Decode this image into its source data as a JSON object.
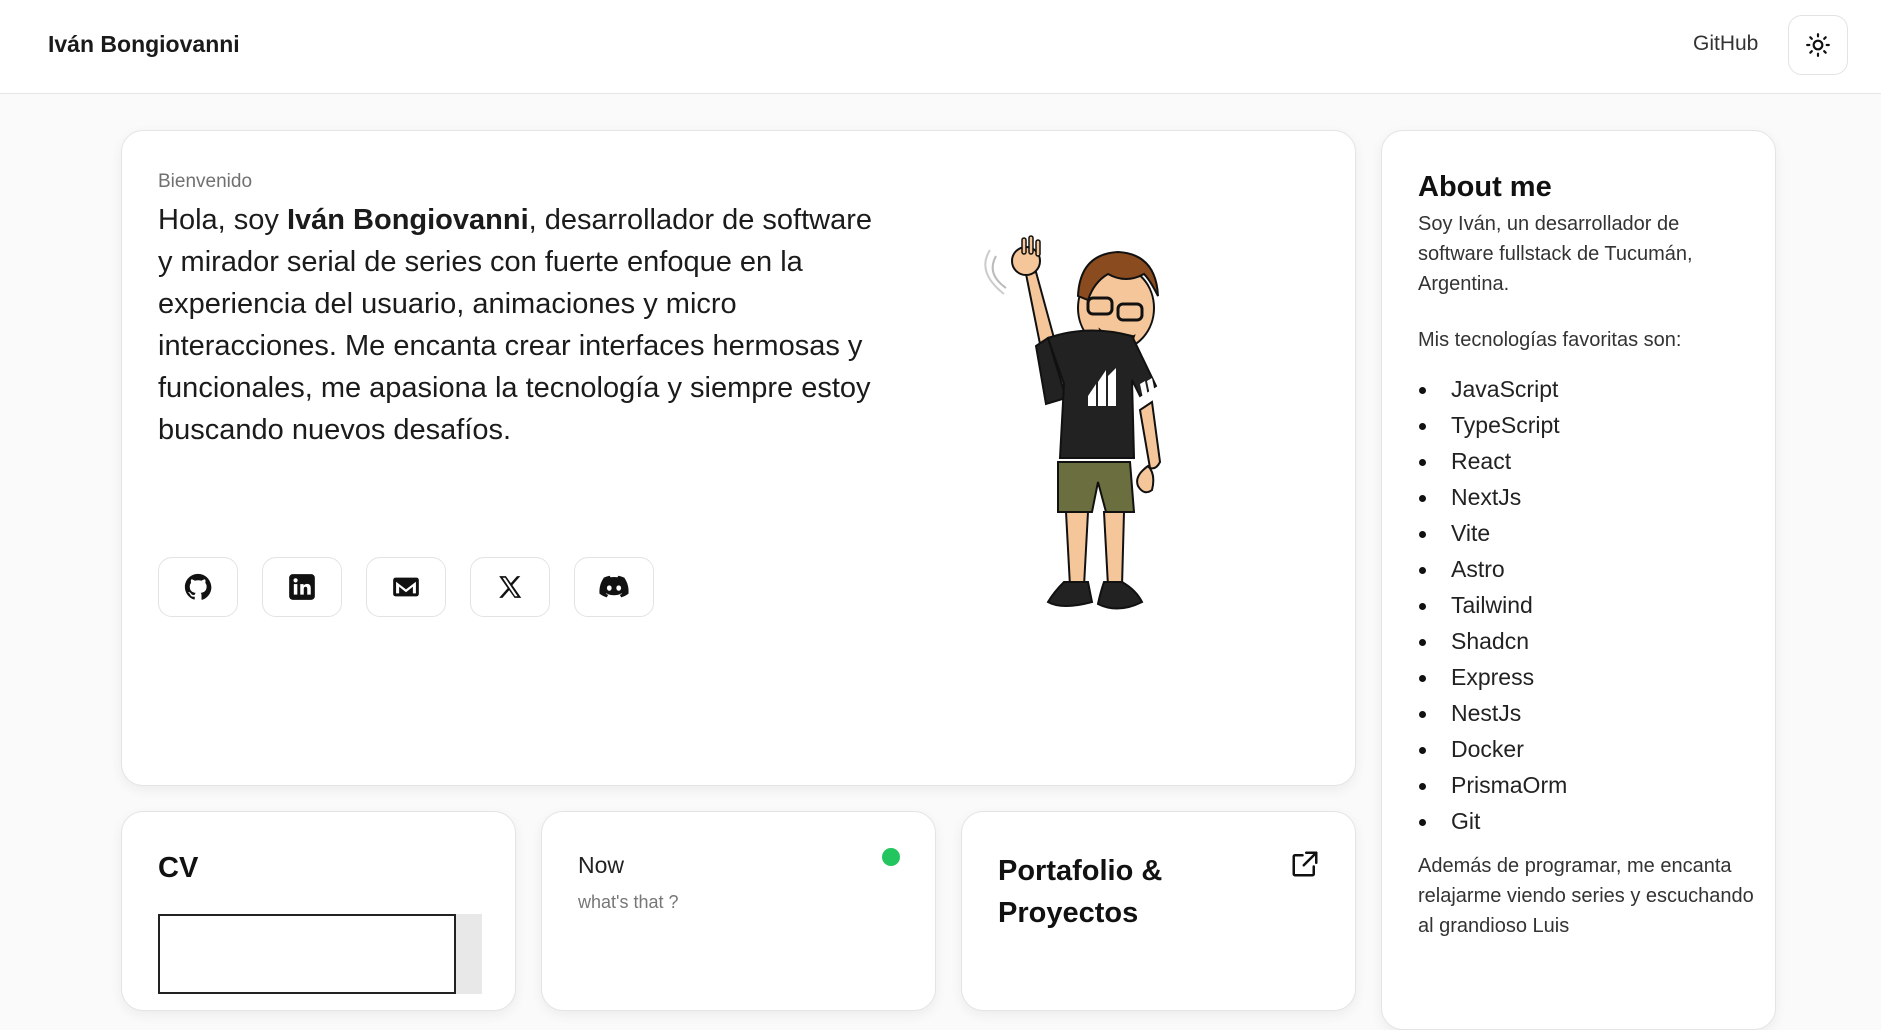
{
  "header": {
    "brand": "Iván Bongiovanni",
    "github_label": "GitHub",
    "theme_icon": "sun-icon"
  },
  "hero": {
    "welcome": "Bienvenido",
    "intro_before": "Hola, soy ",
    "intro_name": "Iván Bongiovanni",
    "intro_after": ", desarrollador de software y mirador serial de series con fuerte enfoque en la experiencia del usuario, animaciones y micro interacciones. Me encanta crear interfaces hermosas y funcionales, me apasiona la tecnología y siempre estoy buscando nuevos desafíos.",
    "socials": [
      {
        "icon": "github-icon"
      },
      {
        "icon": "linkedin-icon"
      },
      {
        "icon": "mail-icon"
      },
      {
        "icon": "x-icon"
      },
      {
        "icon": "discord-icon"
      }
    ],
    "avatar_icon": "waving-avatar-illustration"
  },
  "about": {
    "title": "About me",
    "p1": "Soy Iván, un desarrollador de software fullstack de Tucumán, Argentina.",
    "p2": "Mis tecnologías favoritas son:",
    "techs": [
      "JavaScript",
      "TypeScript",
      "React",
      "NextJs",
      "Vite",
      "Astro",
      "Tailwind",
      "Shadcn",
      "Express",
      "NestJs",
      "Docker",
      "PrismaOrm",
      "Git"
    ],
    "p3": "Además de programar, me encanta relajarme viendo series y escuchando al grandioso Luis"
  },
  "cv": {
    "title": "CV"
  },
  "now": {
    "title": "Now",
    "subtitle": "what's that ?",
    "status_color": "#22c55e"
  },
  "portfolio": {
    "title": "Portafolio & Proyectos",
    "ext_icon": "external-link-icon"
  }
}
